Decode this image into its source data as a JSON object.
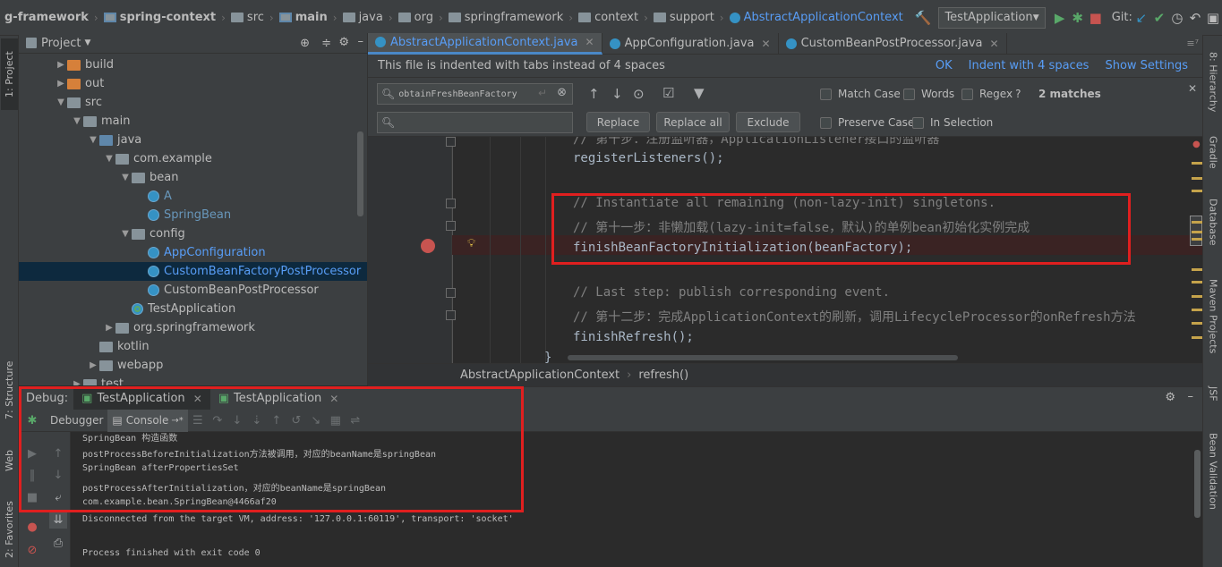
{
  "navbar": {
    "crumbs": [
      "g-framework",
      "spring-context",
      "src",
      "main",
      "java",
      "org",
      "springframework",
      "context",
      "support",
      "AbstractApplicationContext"
    ],
    "run_config": "TestApplication",
    "git_label": "Git:"
  },
  "left_tabs": [
    "1: Project",
    "7: Structure",
    "Web",
    "2: Favorites"
  ],
  "right_tabs": [
    "8: Hierarchy",
    "Gradle",
    "Database",
    "Maven Projects",
    "JSF",
    "Bean Validation"
  ],
  "project": {
    "title": "Project",
    "tree": [
      {
        "label": "build",
        "indent": 1,
        "arrow": "▶",
        "icon": "orange"
      },
      {
        "label": "out",
        "indent": 1,
        "arrow": "▶",
        "icon": "orange"
      },
      {
        "label": "src",
        "indent": 1,
        "arrow": "▼",
        "icon": "gray"
      },
      {
        "label": "main",
        "indent": 2,
        "arrow": "▼",
        "icon": "gray"
      },
      {
        "label": "java",
        "indent": 3,
        "arrow": "▼",
        "icon": "blue"
      },
      {
        "label": "com.example",
        "indent": 4,
        "arrow": "▼",
        "icon": "gray"
      },
      {
        "label": "bean",
        "indent": 5,
        "arrow": "▼",
        "icon": "gray"
      },
      {
        "label": "A",
        "indent": 6,
        "arrow": "",
        "icon": "class",
        "color": "blue"
      },
      {
        "label": "SpringBean",
        "indent": 6,
        "arrow": "",
        "icon": "class",
        "color": "blue"
      },
      {
        "label": "config",
        "indent": 5,
        "arrow": "▼",
        "icon": "gray"
      },
      {
        "label": "AppConfiguration",
        "indent": 6,
        "arrow": "",
        "icon": "class",
        "color": "lightblue"
      },
      {
        "label": "CustomBeanFactoryPostProcessor",
        "indent": 6,
        "arrow": "",
        "icon": "class",
        "color": "lightblue",
        "selected": true
      },
      {
        "label": "CustomBeanPostProcessor",
        "indent": 6,
        "arrow": "",
        "icon": "class",
        "color": "normal"
      },
      {
        "label": "TestApplication",
        "indent": 5,
        "arrow": "",
        "icon": "runclass",
        "color": "normal"
      },
      {
        "label": "org.springframework",
        "indent": 4,
        "arrow": "▶",
        "icon": "gray"
      },
      {
        "label": "kotlin",
        "indent": 3,
        "arrow": "",
        "icon": "gray"
      },
      {
        "label": "webapp",
        "indent": 3,
        "arrow": "▶",
        "icon": "gray"
      },
      {
        "label": "test",
        "indent": 2,
        "arrow": "▶",
        "icon": "gray"
      }
    ]
  },
  "editor_tabs": [
    {
      "label": "AbstractApplicationContext.java",
      "active": true
    },
    {
      "label": "AppConfiguration.java",
      "active": false
    },
    {
      "label": "CustomBeanPostProcessor.java",
      "active": false
    }
  ],
  "tabs_overflow": "≡⁷",
  "banner": {
    "message": "This file is indented with tabs instead of 4 spaces",
    "ok": "OK",
    "indent4": "Indent with 4 spaces",
    "show_settings": "Show Settings"
  },
  "find": {
    "search_value": "obtainFreshBeanFactory",
    "replace_value": "",
    "replace_btn": "Replace",
    "replace_all_btn": "Replace all",
    "exclude_btn": "Exclude",
    "match_case": "Match Case",
    "words": "Words",
    "regex": "Regex",
    "regex_help": "?",
    "matches": "2 matches",
    "preserve_case": "Preserve Case",
    "in_selection": "In Selection"
  },
  "code": {
    "line0": "// 第十步：注册监听器，ApplicationListener接口的监听器",
    "line1": "registerListeners();",
    "line3": "// Instantiate all remaining (non-lazy-init) singletons.",
    "line4": "// 第十一步：非懒加载(lazy-init=false，默认)的单例bean初始化实例完成",
    "line5": "finishBeanFactoryInitialization(beanFactory);",
    "line7": "// Last step: publish corresponding event.",
    "line8": "// 第十二步：完成ApplicationContext的刷新，调用LifecycleProcessor的onRefresh方法",
    "line9": "finishRefresh();",
    "line10": "}"
  },
  "editor_crumb": {
    "cls": "AbstractApplicationContext",
    "method": "refresh()"
  },
  "debug": {
    "label": "Debug:",
    "tabs": [
      "TestApplication",
      "TestApplication"
    ],
    "debugger_tab": "Debugger",
    "console_tab": "Console",
    "console_arrow": "→*"
  },
  "console_lines": [
    "SpringBean 构造函数",
    "postProcessBeforeInitialization方法被调用，对应的beanName是springBean",
    "SpringBean afterPropertiesSet",
    "postProcessAfterInitialization，对应的beanName是springBean",
    "com.example.bean.SpringBean@4466af20",
    "Disconnected from the target VM, address: '127.0.0.1:60119', transport: 'socket'",
    "",
    "Process finished with exit code 0"
  ]
}
